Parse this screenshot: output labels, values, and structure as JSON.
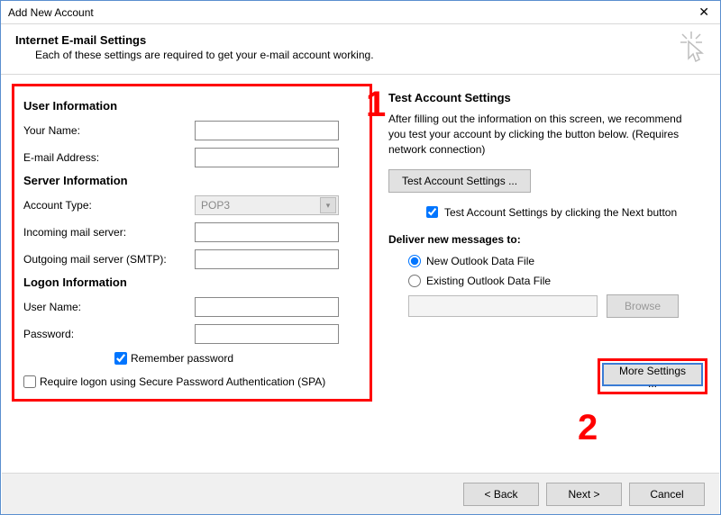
{
  "window": {
    "title": "Add New Account"
  },
  "header": {
    "title": "Internet E-mail Settings",
    "subtitle": "Each of these settings are required to get your e-mail account working."
  },
  "left": {
    "user_info_title": "User Information",
    "your_name_label": "Your Name:",
    "your_name_value": "",
    "email_label": "E-mail Address:",
    "email_value": "",
    "server_info_title": "Server Information",
    "account_type_label": "Account Type:",
    "account_type_value": "POP3",
    "incoming_label": "Incoming mail server:",
    "incoming_value": "",
    "outgoing_label": "Outgoing mail server (SMTP):",
    "outgoing_value": "",
    "logon_info_title": "Logon Information",
    "username_label": "User Name:",
    "username_value": "",
    "password_label": "Password:",
    "password_value": "",
    "remember_pw_label": "Remember password",
    "spa_label": "Require logon using Secure Password Authentication (SPA)"
  },
  "right": {
    "test_title": "Test Account Settings",
    "test_text": "After filling out the information on this screen, we recommend you test your account by clicking the button below. (Requires network connection)",
    "test_button": "Test Account Settings ...",
    "test_checkbox_label": "Test Account Settings by clicking the Next button",
    "deliver_title": "Deliver new messages to:",
    "radio_new": "New Outlook Data File",
    "radio_existing": "Existing Outlook Data File",
    "browse_button": "Browse",
    "more_button": "More Settings ..."
  },
  "footer": {
    "back": "< Back",
    "next": "Next >",
    "cancel": "Cancel"
  },
  "callouts": {
    "one": "1",
    "two": "2"
  }
}
